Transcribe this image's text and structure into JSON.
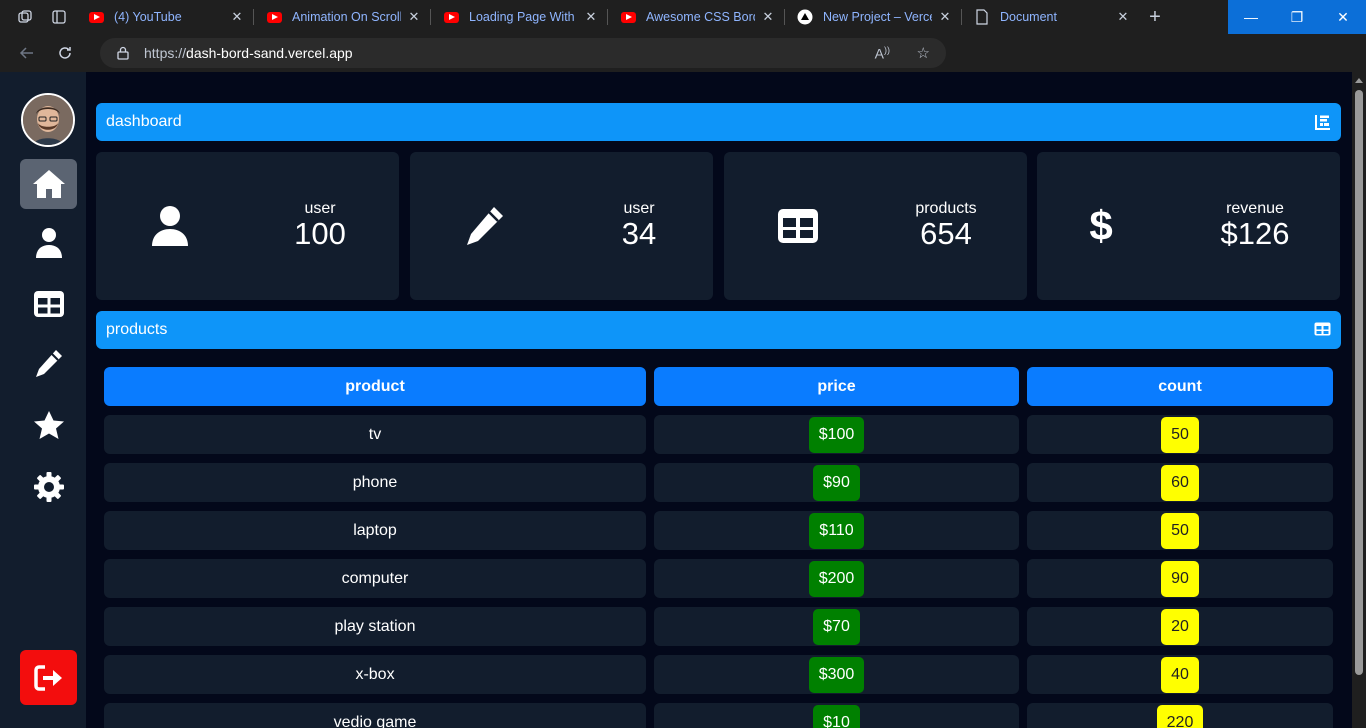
{
  "browser": {
    "tabs": [
      {
        "title": "(4) YouTube",
        "icon": "youtube-icon"
      },
      {
        "title": "Animation On Scroll |",
        "icon": "youtube-icon"
      },
      {
        "title": "Loading Page With S",
        "icon": "youtube-icon"
      },
      {
        "title": "Awesome CSS Borde",
        "icon": "youtube-icon"
      },
      {
        "title": "New Project – Vercel",
        "icon": "vercel-icon"
      },
      {
        "title": "Document",
        "icon": "document-icon"
      }
    ],
    "url_prefix": "https://",
    "url_host": "dash-bord-sand.vercel.app"
  },
  "sidebar": {
    "items": [
      {
        "name": "home",
        "icon": "home-icon",
        "active": true
      },
      {
        "name": "user",
        "icon": "user-icon"
      },
      {
        "name": "table",
        "icon": "table-icon"
      },
      {
        "name": "edit",
        "icon": "pencil-icon"
      },
      {
        "name": "favorites",
        "icon": "star-icon"
      },
      {
        "name": "settings",
        "icon": "gear-icon"
      }
    ],
    "logout_icon": "logout-icon",
    "logout_color": "#f30d0d"
  },
  "dashboard": {
    "title": "dashboard",
    "accent": "#0e95f9",
    "cards": [
      {
        "label": "user",
        "value": "100",
        "icon": "user-icon"
      },
      {
        "label": "user",
        "value": "34",
        "icon": "pencil-icon"
      },
      {
        "label": "products",
        "value": "654",
        "icon": "table-icon"
      },
      {
        "label": "revenue",
        "value": "$126",
        "icon": "dollar-icon"
      }
    ]
  },
  "products": {
    "title": "products",
    "columns": [
      "product",
      "price",
      "count"
    ],
    "rows": [
      {
        "product": "tv",
        "price": "$100",
        "count": "50"
      },
      {
        "product": "phone",
        "price": "$90",
        "count": "60"
      },
      {
        "product": "laptop",
        "price": "$110",
        "count": "50"
      },
      {
        "product": "computer",
        "price": "$200",
        "count": "90"
      },
      {
        "product": "play station",
        "price": "$70",
        "count": "20"
      },
      {
        "product": "x-box",
        "price": "$300",
        "count": "40"
      },
      {
        "product": "vedio game",
        "price": "$10",
        "count": "220"
      }
    ],
    "price_color": "#008000",
    "count_color": "#ffff00"
  }
}
